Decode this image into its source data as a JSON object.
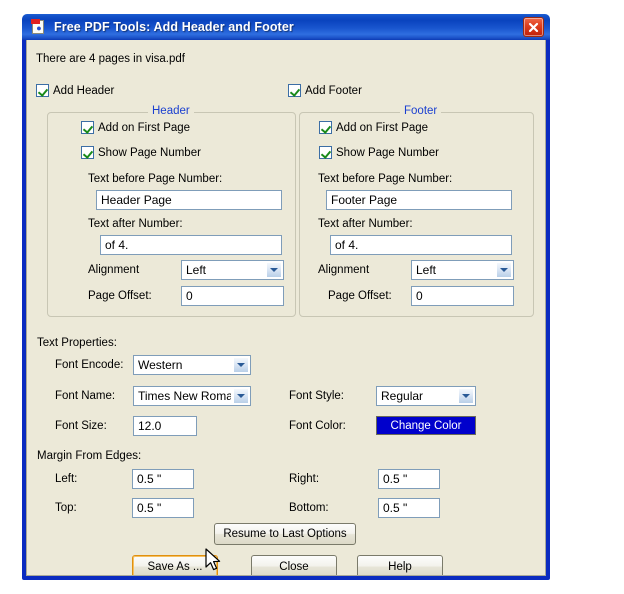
{
  "window": {
    "title": "Free PDF Tools: Add Header and Footer",
    "icon": "pdf-document-icon",
    "close_label": "x",
    "accent_title_color": "#0A43BE",
    "client_bg_color": "#ECE9D8"
  },
  "info": {
    "page_count_text": "There are 4 pages in visa.pdf"
  },
  "toggles": {
    "add_header": "Add Header",
    "add_footer": "Add Footer"
  },
  "header_group": {
    "legend": "Header",
    "add_on_first_page": "Add on First Page",
    "show_page_number": "Show Page Number",
    "text_before_label": "Text before Page Number:",
    "text_before_value": "Header Page",
    "text_after_label": "Text after Number:",
    "text_after_value": "of 4.",
    "alignment_label": "Alignment",
    "alignment_value": "Left",
    "page_offset_label": "Page Offset:",
    "page_offset_value": "0"
  },
  "footer_group": {
    "legend": "Footer",
    "add_on_first_page": "Add on First Page",
    "show_page_number": "Show Page Number",
    "text_before_label": "Text before Page Number:",
    "text_before_value": "Footer Page",
    "text_after_label": "Text after Number:",
    "text_after_value": "of 4.",
    "alignment_label": "Alignment",
    "alignment_value": "Left",
    "page_offset_label": "Page Offset:",
    "page_offset_value": "0"
  },
  "text_properties": {
    "section_label": "Text Properties:",
    "font_encode_label": "Font Encode:",
    "font_encode_value": "Western",
    "font_name_label": "Font Name:",
    "font_name_value": "Times New Roman",
    "font_size_label": "Font Size:",
    "font_size_value": "12.0",
    "font_style_label": "Font Style:",
    "font_style_value": "Regular",
    "font_color_label": "Font Color:",
    "change_color_label": "Change Color",
    "change_color_swatch": "#0000CC"
  },
  "margins": {
    "section_label": "Margin From Edges:",
    "left_label": "Left:",
    "left_value": "0.5 \"",
    "top_label": "Top:",
    "top_value": "0.5 \"",
    "right_label": "Right:",
    "right_value": "0.5 \"",
    "bottom_label": "Bottom:",
    "bottom_value": "0.5 \""
  },
  "actions": {
    "resume": "Resume to Last Options",
    "save_as": "Save As ...",
    "close": "Close",
    "help": "Help"
  }
}
